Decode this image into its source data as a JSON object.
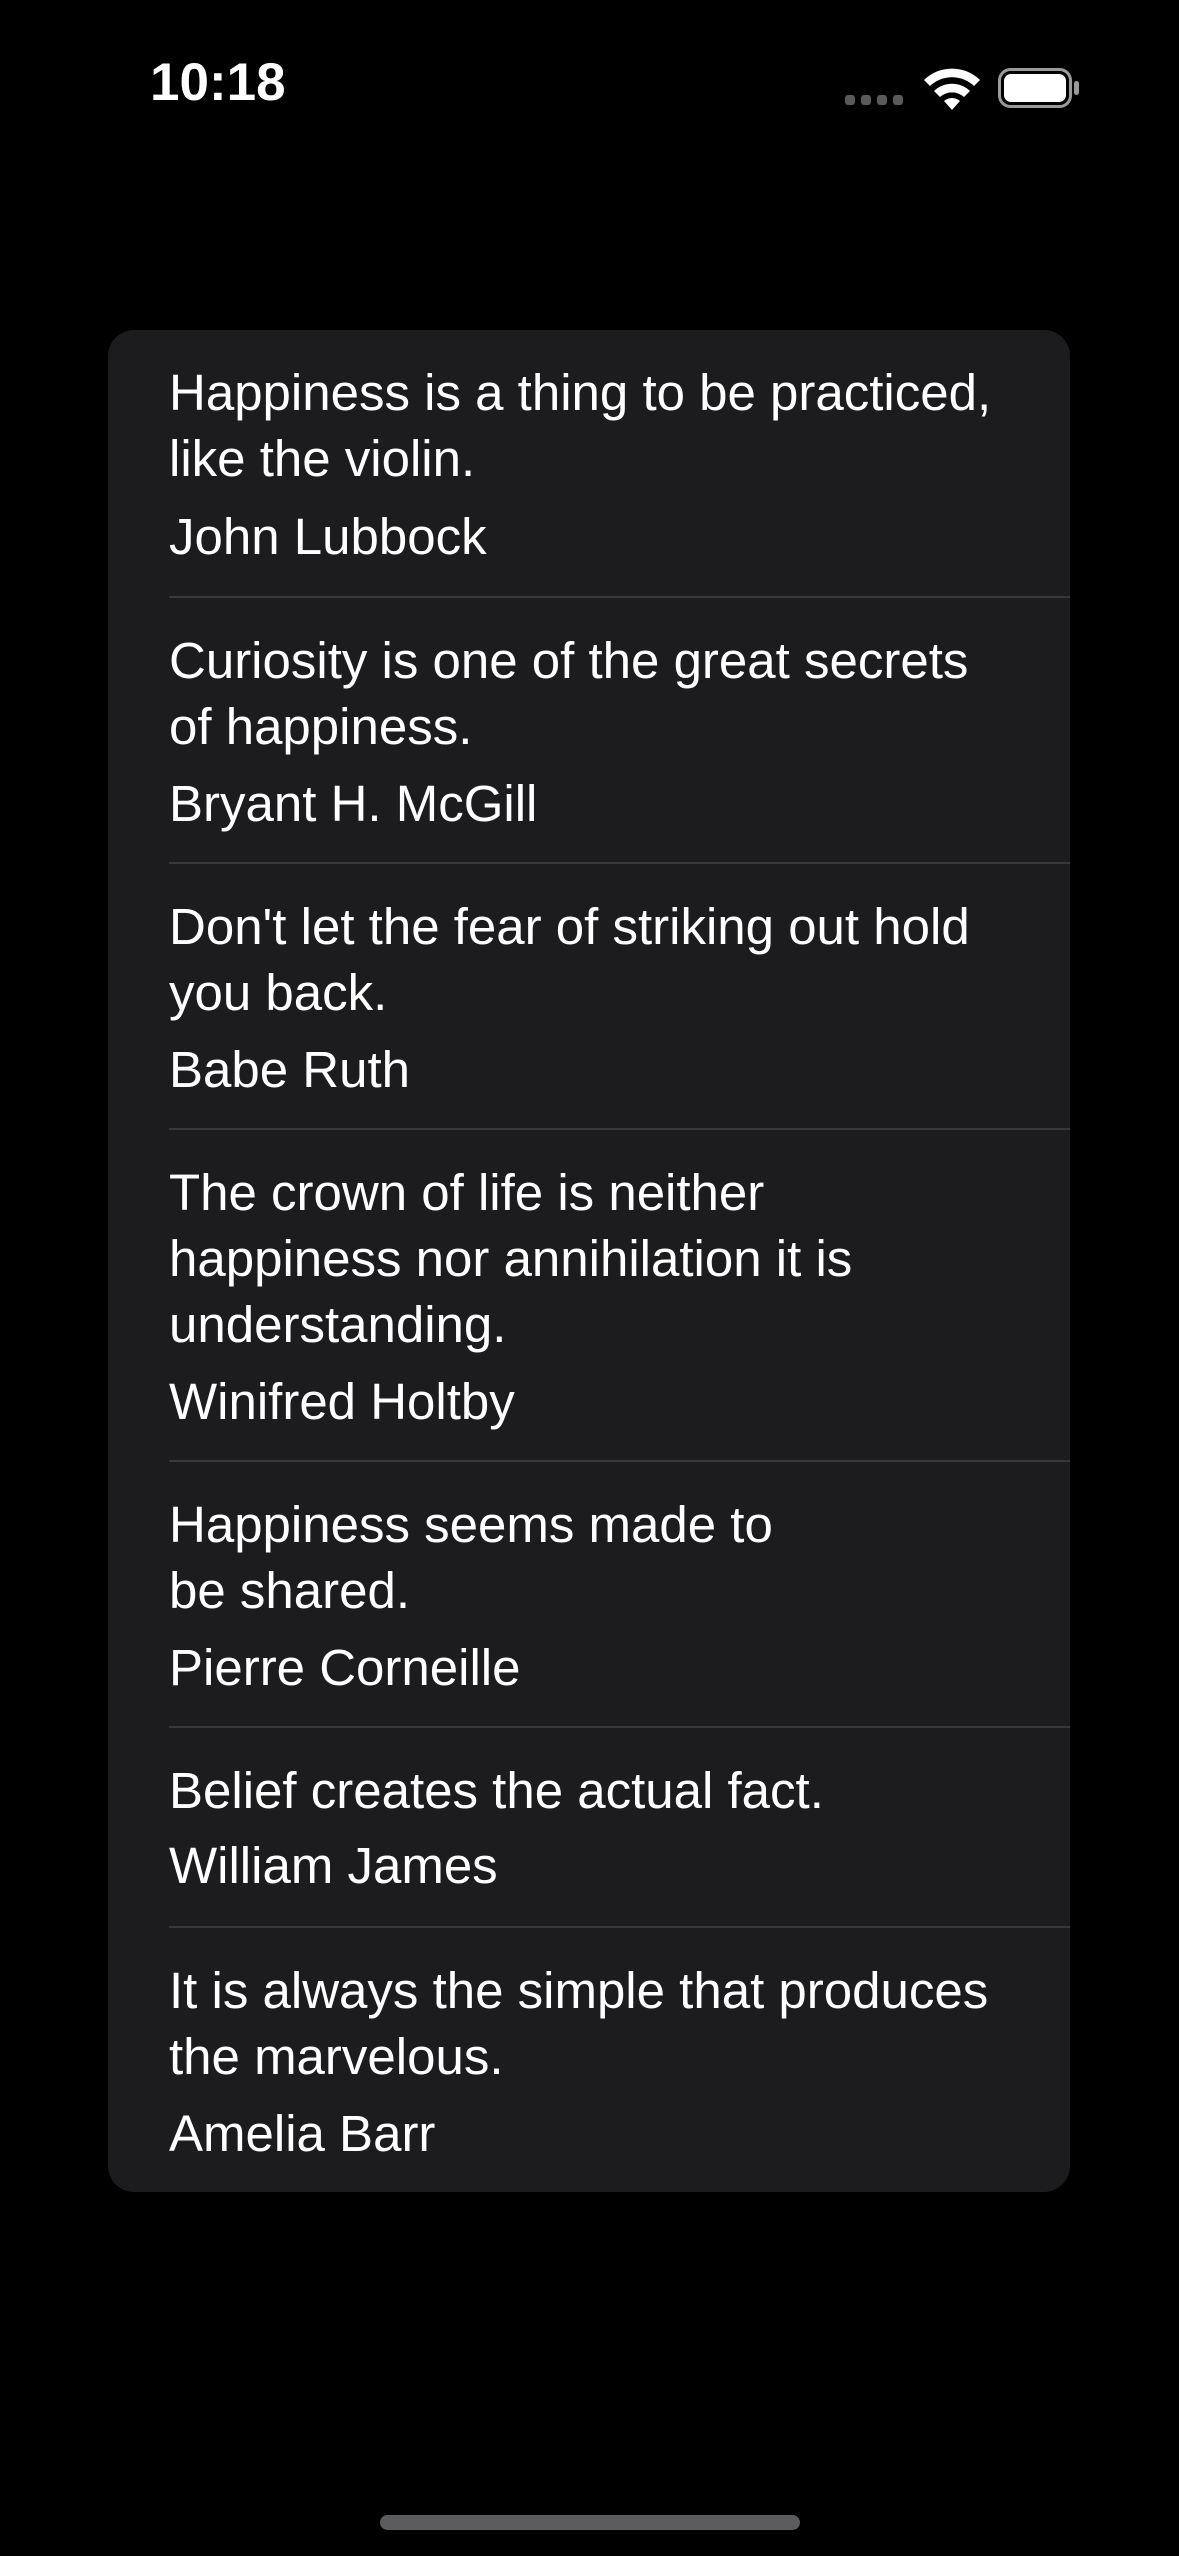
{
  "status_bar": {
    "time": "10:18",
    "icons": [
      "cellular-signal-icon",
      "wifi-icon",
      "battery-icon"
    ]
  },
  "colors": {
    "background": "#000000",
    "card": "#1c1c1e",
    "separator": "#38383a",
    "text": "#ffffff"
  },
  "quotes": [
    {
      "lines": [
        "Happiness is a thing to be practiced,",
        "like the violin."
      ],
      "author": "John Lubbock"
    },
    {
      "lines": [
        "Curiosity is one of the great secrets",
        "of happiness."
      ],
      "author": "Bryant H. McGill"
    },
    {
      "lines": [
        "Don't let the fear of striking out hold",
        "you back."
      ],
      "author": "Babe Ruth"
    },
    {
      "lines": [
        "The crown of life is neither",
        "happiness nor annihilation it is",
        "understanding."
      ],
      "author": "Winifred Holtby"
    },
    {
      "lines": [
        "Happiness seems made to",
        "be shared."
      ],
      "author": "Pierre Corneille"
    },
    {
      "lines": [
        "Belief creates the actual fact."
      ],
      "author": "William James"
    },
    {
      "lines": [
        "It is always the simple that produces",
        "the marvelous."
      ],
      "author": "Amelia Barr"
    }
  ]
}
